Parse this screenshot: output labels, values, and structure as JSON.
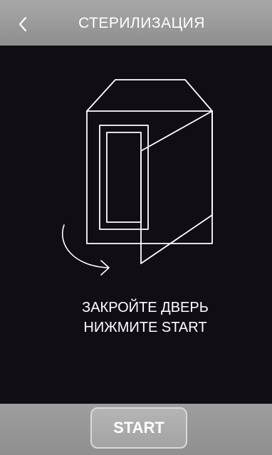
{
  "header": {
    "title": "СТЕРИЛИЗАЦИЯ",
    "back_icon": "chevron-left-icon"
  },
  "illustration": {
    "icon": "open-door-cabinet-icon",
    "arrow_icon": "curved-arrow-icon"
  },
  "instruction": {
    "line1": "ЗАКРОЙТЕ ДВЕРЬ",
    "line2": "НИЖМИТЕ START"
  },
  "footer": {
    "start_label": "START"
  },
  "colors": {
    "background": "#100e14",
    "bar": "#9a9a9a",
    "text": "#ffffff"
  }
}
